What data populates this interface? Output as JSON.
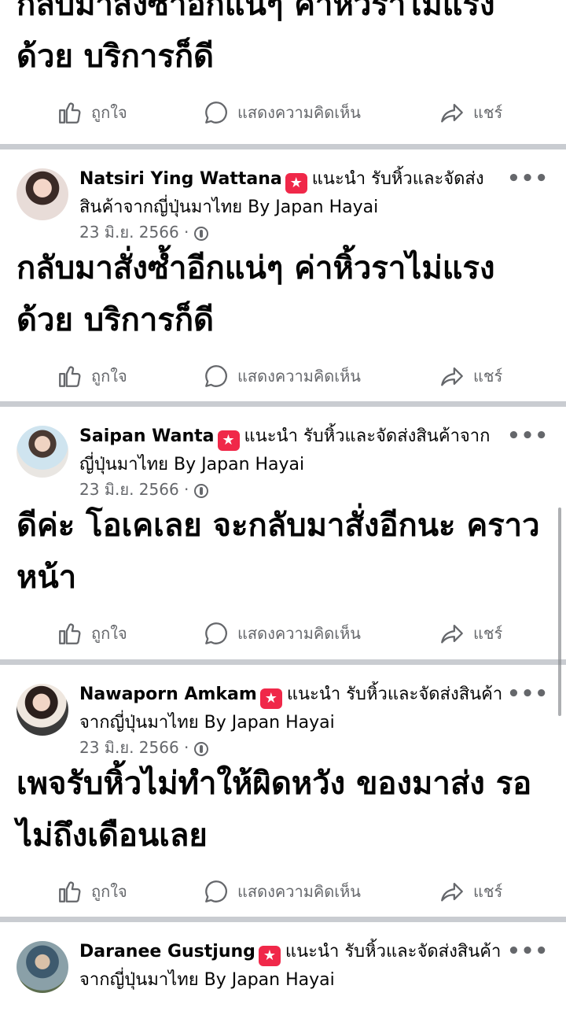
{
  "actions": {
    "like": "ถูกใจ",
    "comment": "แสดงความคิดเห็น",
    "share": "แชร์"
  },
  "top_post": {
    "text": "กลับมาสั่งซ้ำอีกแน่ๆ ค่าหิ้วราไม่แรง ด้วย บริการก็ดี"
  },
  "posts": [
    {
      "name": "Natsiri Ying Wattana",
      "badge_icon": "star-icon",
      "recommend": "แนะนำ รับหิ้วและจัดส่งสินค้าจากญี่ปุ่นมาไทย By Japan Hayai",
      "date": "23 มิ.ย. 2566 ·",
      "text": "กลับมาสั่งซ้ำอีกแน่ๆ ค่าหิ้วราไม่แรง ด้วย บริการก็ดี"
    },
    {
      "name": "Saipan Wanta",
      "badge_icon": "star-icon",
      "recommend": "แนะนำ รับหิ้วและจัดส่งสินค้าจากญี่ปุ่นมาไทย By Japan Hayai",
      "date": "23 มิ.ย. 2566 ·",
      "text": "ดีค่ะ โอเคเลย จะกลับมาสั่งอีกนะ คราวหน้า"
    },
    {
      "name": "Nawaporn Amkam",
      "badge_icon": "star-icon",
      "recommend": "แนะนำ รับหิ้วและจัดส่งสินค้าจากญี่ปุ่นมาไทย By Japan Hayai",
      "date": "23 มิ.ย. 2566 ·",
      "text": "เพจรับหิ้วไม่ทำให้ผิดหวัง ของมาส่ง รอไม่ถึงเดือนเลย"
    },
    {
      "name": "Daranee Gustjung",
      "badge_icon": "star-icon",
      "recommend": "แนะนำ รับหิ้วและจัดส่งสินค้าจากญี่ปุ่นมาไทย By Japan Hayai"
    }
  ],
  "more_glyph": "•••",
  "badge_glyph": "★"
}
